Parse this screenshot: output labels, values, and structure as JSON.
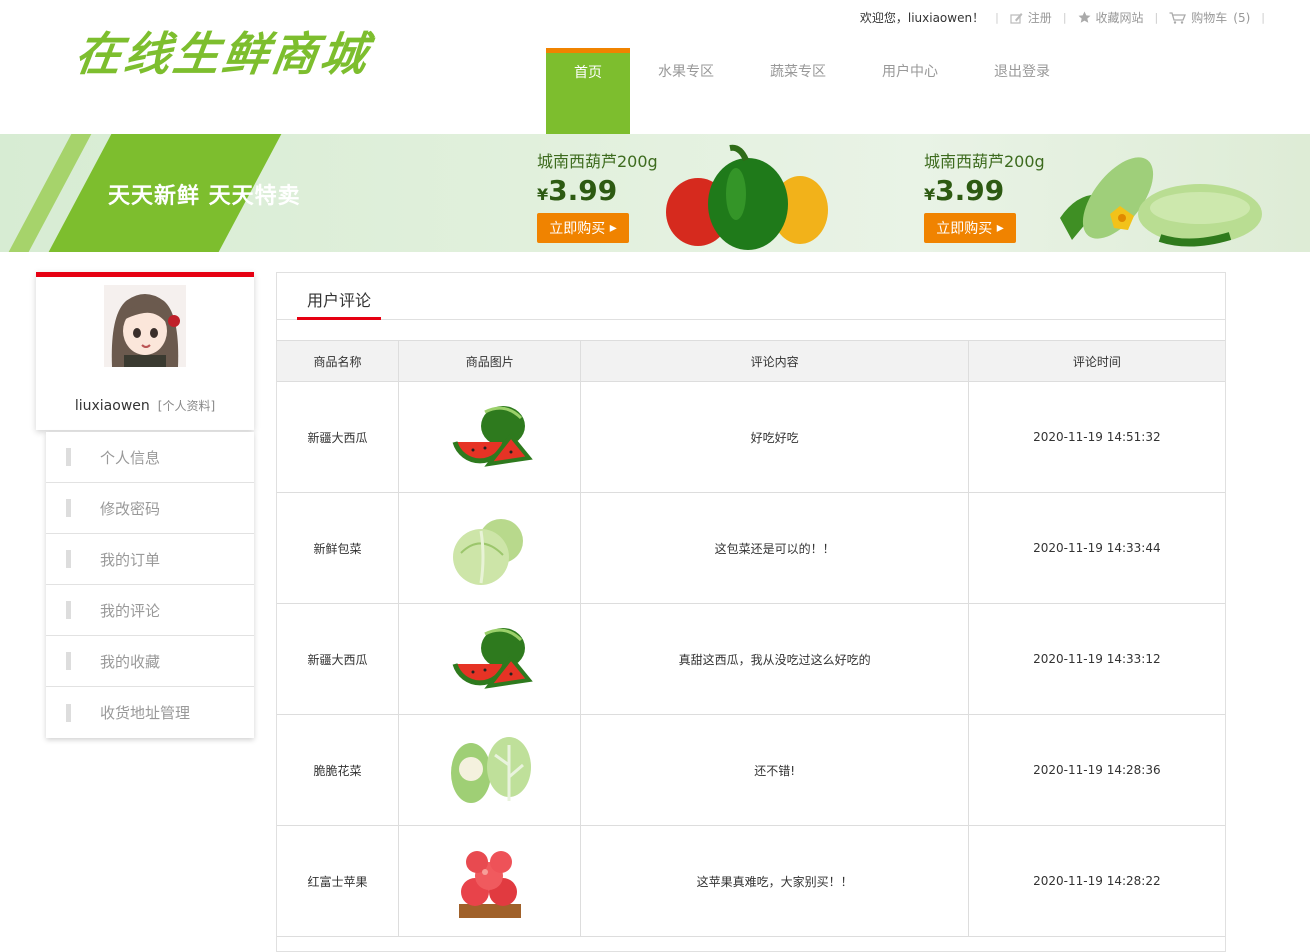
{
  "header": {
    "logo_text": "在线生鲜商城",
    "welcome": "欢迎您，liuxiaowen！",
    "register": "注册",
    "favorite_site": "收藏网站",
    "cart_label": "购物车",
    "cart_count": "(5)"
  },
  "nav": [
    {
      "label": "首页"
    },
    {
      "label": "水果专区"
    },
    {
      "label": "蔬菜专区"
    },
    {
      "label": "用户中心"
    },
    {
      "label": "退出登录"
    }
  ],
  "banner": {
    "slogan": "天天新鲜  天天特卖",
    "promos": [
      {
        "name": "城南西葫芦200g",
        "currency": "¥",
        "price": "3.99",
        "button": "立即购买"
      },
      {
        "name": "城南西葫芦200g",
        "currency": "¥",
        "price": "3.99",
        "button": "立即购买"
      }
    ]
  },
  "sidebar": {
    "username": "liuxiaowen",
    "profile_link": "[个人资料]",
    "menu": [
      {
        "label": "个人信息"
      },
      {
        "label": "修改密码"
      },
      {
        "label": "我的订单"
      },
      {
        "label": "我的评论"
      },
      {
        "label": "我的收藏"
      },
      {
        "label": "收货地址管理"
      }
    ]
  },
  "content": {
    "tab": "用户评论",
    "columns": [
      "商品名称",
      "商品图片",
      "评论内容",
      "评论时间"
    ],
    "rows": [
      {
        "name": "新疆大西瓜",
        "image": "watermelon-image",
        "comment": "好吃好吃",
        "time": "2020-11-19 14:51:32"
      },
      {
        "name": "新鲜包菜",
        "image": "cabbage-image",
        "comment": "这包菜还是可以的！！",
        "time": "2020-11-19 14:33:44"
      },
      {
        "name": "新疆大西瓜",
        "image": "watermelon-image",
        "comment": "真甜这西瓜，我从没吃过这么好吃的",
        "time": "2020-11-19 14:33:12"
      },
      {
        "name": "脆脆花菜",
        "image": "cauliflower-image",
        "comment": "还不错!",
        "time": "2020-11-19 14:28:36"
      },
      {
        "name": "红富士苹果",
        "image": "apple-image",
        "comment": "这苹果真难吃，大家别买！！",
        "time": "2020-11-19 14:28:22"
      }
    ]
  },
  "colors": {
    "brand_green": "#7dbe2e",
    "accent_orange": "#f08300",
    "accent_red": "#e60012"
  }
}
